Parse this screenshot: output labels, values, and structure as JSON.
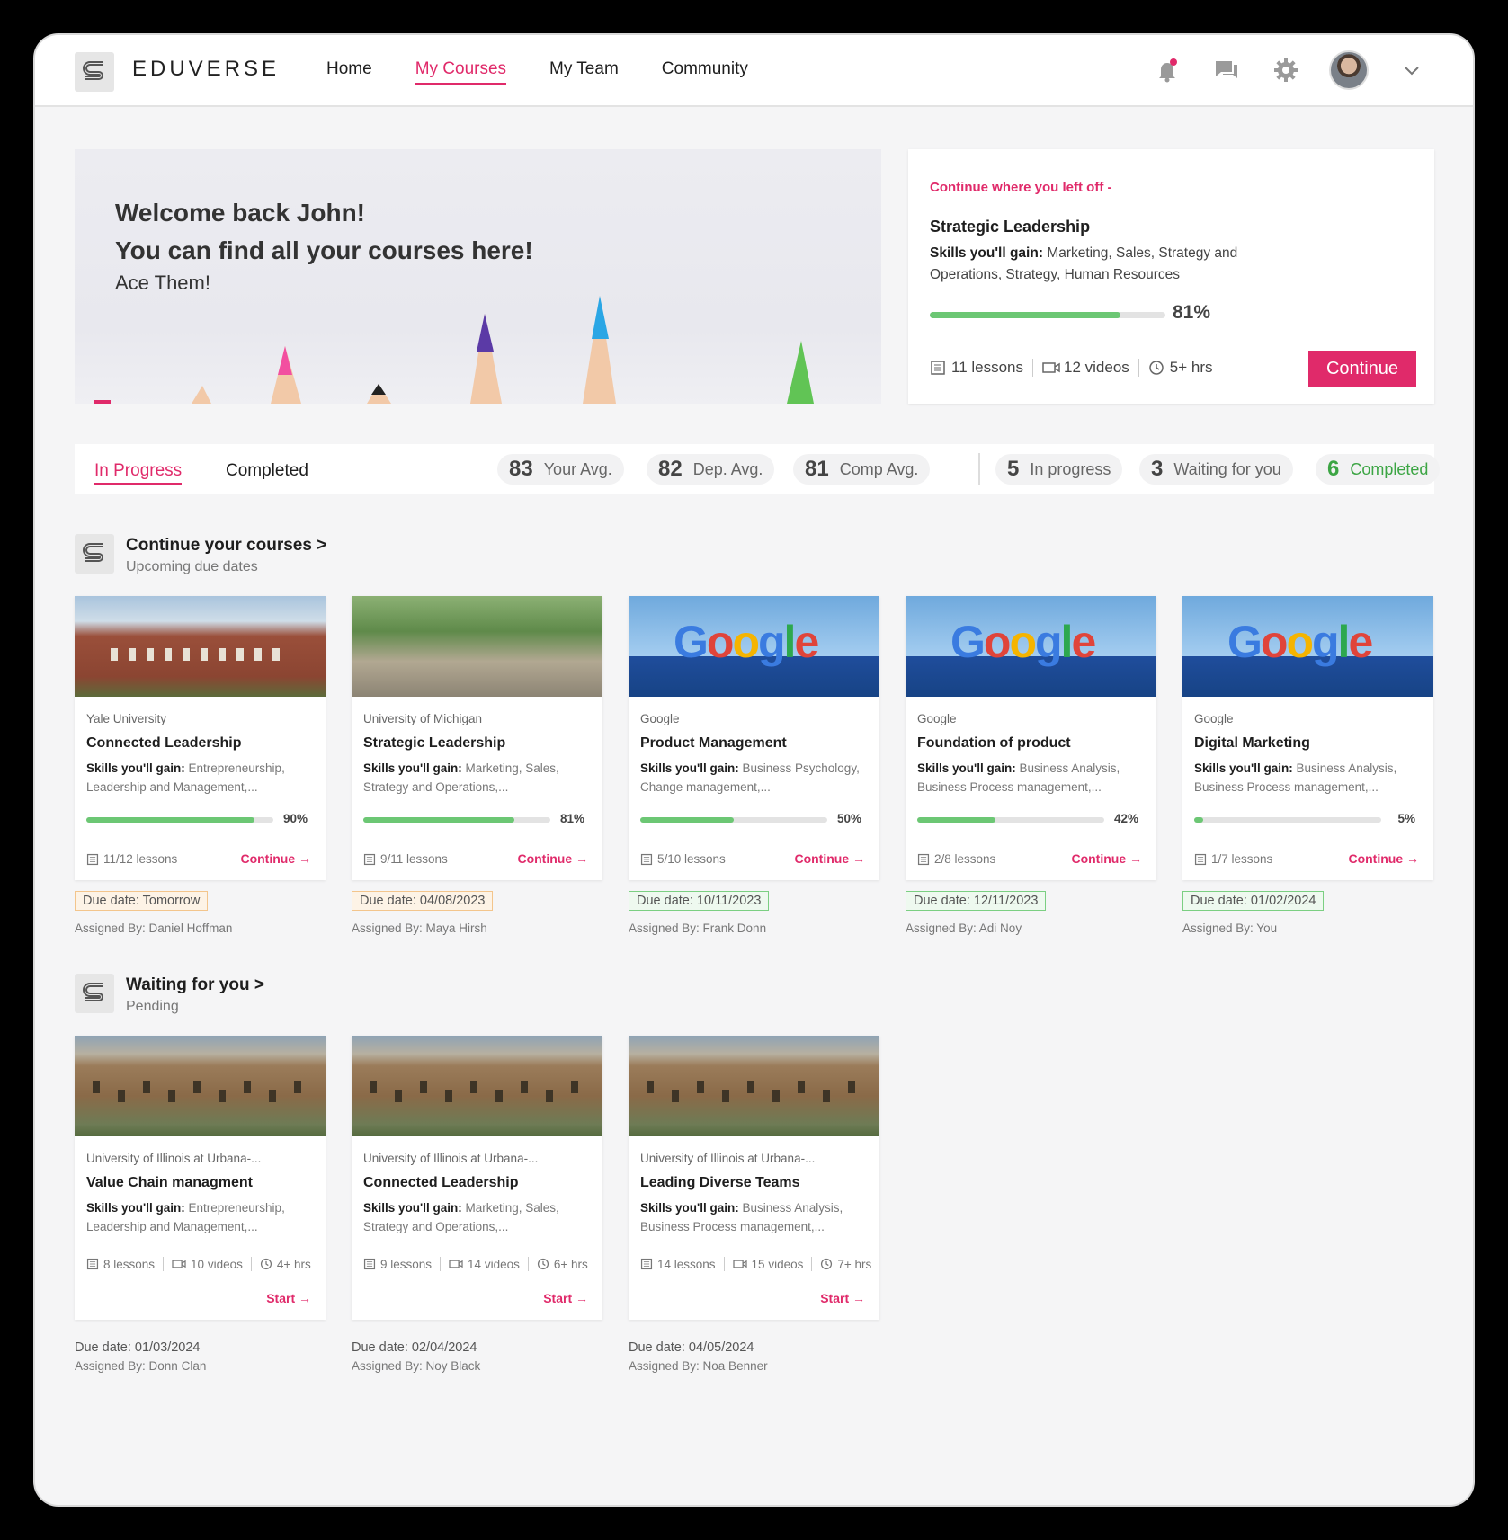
{
  "nav": {
    "brand": "EDUVERSE",
    "items": [
      "Home",
      "My Courses",
      "My Team",
      "Community"
    ],
    "active": "My Courses"
  },
  "hero": {
    "line1": "Welcome back John!",
    "line2": "You can find all your courses here!",
    "line3": "Ace Them!"
  },
  "continue_card": {
    "heading": "Continue where you left off -",
    "title": "Strategic Leadership",
    "skills_label": "Skills you'll gain:",
    "skills": "Marketing, Sales, Strategy and Operations, Strategy, Human Resources",
    "progress": 81,
    "progress_label": "81%",
    "lessons": "11 lessons",
    "videos": "12 videos",
    "hours": "5+ hrs",
    "button": "Continue"
  },
  "tabs": [
    "In Progress",
    "Completed"
  ],
  "stats": [
    {
      "value": "83",
      "label": "Your Avg."
    },
    {
      "value": "82",
      "label": "Dep. Avg."
    },
    {
      "value": "81",
      "label": "Comp Avg."
    },
    {
      "value": "5",
      "label": "In progress"
    },
    {
      "value": "3",
      "label": "Waiting for you"
    },
    {
      "value": "6",
      "label": "Completed"
    }
  ],
  "colors": {
    "accent": "#e02a6a",
    "progress": "#6cc774",
    "completed": "#3ca544"
  },
  "section1": {
    "title": "Continue your courses >",
    "subtitle": "Upcoming due dates"
  },
  "in_progress": [
    {
      "org": "Yale University",
      "title": "Connected Leadership",
      "skills_label": "Skills you'll gain:",
      "skills": "Entrepreneurship, Leadership and Management,...",
      "progress": 90,
      "pct": "90%",
      "lessons": "11/12 lessons",
      "action": "Continue →",
      "due": "Due date: Tomorrow",
      "assigned": "Assigned By: Daniel Hoffman",
      "image": "yale-building"
    },
    {
      "org": "University of Michigan",
      "title": "Strategic Leadership",
      "skills_label": "Skills you'll gain:",
      "skills": "Marketing, Sales, Strategy and Operations,...",
      "progress": 81,
      "pct": "81%",
      "lessons": "9/11 lessons",
      "action": "Continue →",
      "due": "Due date: 04/08/2023",
      "assigned": "Assigned By: Maya Hirsh",
      "image": "campus-park"
    },
    {
      "org": "Google",
      "title": "Product Management",
      "skills_label": "Skills you'll gain:",
      "skills": "Business Psychology, Change management,...",
      "progress": 50,
      "pct": "50%",
      "lessons": "5/10 lessons",
      "action": "Continue →",
      "due": "Due date: 10/11/2023",
      "assigned": "Assigned By: Frank Donn",
      "image": "google-sign"
    },
    {
      "org": "Google",
      "title": "Foundation of product",
      "skills_label": "Skills you'll gain:",
      "skills": "Business Analysis, Business Process management,...",
      "progress": 42,
      "pct": "42%",
      "lessons": "2/8 lessons",
      "action": "Continue →",
      "due": "Due date: 12/11/2023",
      "assigned": "Assigned By: Adi Noy",
      "image": "google-sign"
    },
    {
      "org": "Google",
      "title": "Digital Marketing",
      "skills_label": "Skills you'll gain:",
      "skills": "Business Analysis, Business Process management,...",
      "progress": 5,
      "pct": "5%",
      "lessons": "1/7 lessons",
      "action": "Continue →",
      "due": "Due date: 01/02/2024",
      "assigned": "Assigned By: You",
      "image": "google-sign"
    }
  ],
  "section2": {
    "title": "Waiting for you >",
    "subtitle": "Pending"
  },
  "waiting": [
    {
      "org": "University of Illinois at Urbana-...",
      "title": "Value Chain managment",
      "skills_label": "Skills you'll gain:",
      "skills": "Entrepreneurship, Leadership and Management,...",
      "lessons": "8 lessons",
      "videos": "10 videos",
      "hours": "4+ hrs",
      "action": "Start →",
      "due": "Due date: 01/03/2024",
      "assigned": "Assigned By: Donn Clan",
      "image": "illinois-building"
    },
    {
      "org": "University of Illinois at Urbana-...",
      "title": "Connected Leadership",
      "skills_label": "Skills you'll gain:",
      "skills": "Marketing, Sales, Strategy and Operations,...",
      "lessons": "9 lessons",
      "videos": "14 videos",
      "hours": "6+ hrs",
      "action": "Start →",
      "due": "Due date: 02/04/2024",
      "assigned": "Assigned By: Noy Black",
      "image": "illinois-building"
    },
    {
      "org": "University of Illinois at Urbana-...",
      "title": "Leading Diverse Teams",
      "skills_label": "Skills you'll gain:",
      "skills": "Business Analysis, Business Process management,...",
      "lessons": "14 lessons",
      "videos": "15 videos",
      "hours": "7+ hrs",
      "action": "Start →",
      "due": "Due date: 04/05/2024",
      "assigned": "Assigned By: Noa Benner",
      "image": "illinois-building"
    }
  ]
}
